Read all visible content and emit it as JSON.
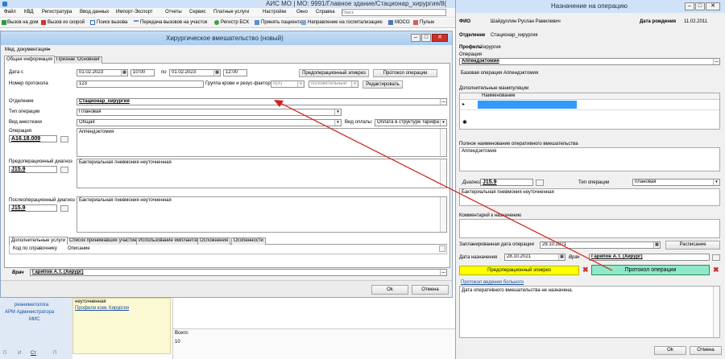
{
  "app": {
    "title": "АИС МО | МО: 9991/Главное здание/Стационар_хирургия/8("
  },
  "menu": {
    "items": [
      "Файл",
      "КВД",
      "Регистратура",
      "Ввод данных",
      "Импорт-Экспорт",
      "Отчеты",
      "Сервис",
      "Платные услуги",
      "Настройки",
      "Окно",
      "Справка"
    ],
    "search_placeholder": "Поиск"
  },
  "toolbar": {
    "items": [
      "Вызов на дом",
      "Вызов из скорой",
      "Поиск вызова",
      "Передача вызовов на участок",
      "Регистр БСК",
      "Принять пациента",
      "Направление на госпитализацию",
      "МОСО",
      "Пульм"
    ]
  },
  "surg": {
    "title": "Хирургическое вмешательство (новый)",
    "med_docs": "Мед. документация",
    "tabs": [
      "Общая информация",
      "Признак 'Основная'"
    ],
    "date_label": "Дата с",
    "date_from": "01.02.2023",
    "time_from": "10:00",
    "po": "по",
    "date_to": "01.02.2023",
    "time_to": "12:00",
    "btn_epicrisis": "Предоперационный эпикриз",
    "btn_protocol": "Протокол операции",
    "protocol_label": "Номер протокола",
    "protocol_value": "123",
    "blood_label": "Группа крови и резус-фактор",
    "blood_value": "II(A)",
    "rh_value": "положительный",
    "btn_edit": "Редактировать",
    "dept_label": "Отделение",
    "dept_value": "Стационар_хирургия",
    "optype_label": "Тип операции",
    "optype_value": "Плановая",
    "anest_label": "Вид анестезии",
    "anest_value": "Общая",
    "pay_label": "Вид оплаты:",
    "pay_value": "Оплата в структуре тарифа",
    "op_label": "Операция",
    "op_code": "A16.18.009",
    "op_text": "Аппендэктомия",
    "preop_label": "Предоперационный диагноз",
    "preop_code": "J15.9",
    "preop_text": "Бактериальная пневмония неуточненная",
    "postop_label": "Послеоперационный диагноз",
    "postop_code": "J15.9",
    "postop_text": "Бактериальная пневмония неуточненная",
    "subtabs": [
      "Дополнительные услуги",
      "Список принимавших участие",
      "Использование имплантов",
      "Осложнения",
      "Особенности"
    ],
    "col_code": "Код по справочнику",
    "col_desc": "Описание",
    "doctor_label": "Врач",
    "doctor_value": "Гарипов А.Т. (Хирург)",
    "btn_ok": "Ok",
    "btn_cancel": "Отмена"
  },
  "bg": {
    "left_items": [
      "реаниматолога",
      "АРМ Администратора",
      "МИС"
    ],
    "info_lines": [
      "неуточненная",
      "Профили коек Хирургия"
    ],
    "total_label": "Всего:",
    "total_value": "10",
    "bottom_tabs": [
      "П",
      "И",
      "Ст",
      "П"
    ]
  },
  "assign": {
    "title": "Назначение на операцию",
    "fio_label": "ФИО",
    "fio_value": "Шайдуллин Руслан Рамилевич",
    "dob_label": "Дата рождения",
    "dob_value": "11.02.2011",
    "dept_label": "Отделение",
    "dept_value": "Стационар_хирургия",
    "profile_label": "Профиль",
    "profile_value": "Хирургия",
    "op_label": "Операция",
    "op_value": "Аппендэктомия",
    "base_op": "Базовая операция  Аппендэктомия",
    "extra_label": "Дополнительные манипуляции",
    "extra_col": "Наименование",
    "full_label": "Полное наименование оперативного вмешательства",
    "full_value": "Аппендэктомия",
    "diag_label": "Диагноз",
    "diag_code": "J15.9",
    "diag_text": "Бактериальная пневмония неуточненная",
    "type_label": "Тип операции",
    "type_value": "плановая",
    "comment_label": "Комментарий к назначению",
    "planned_label": "Запланированная дата операции",
    "planned_value": "28.10.2021",
    "btn_schedule": "Расписание",
    "assign_date_label": "Дата назначения",
    "assign_date_value": "28.10.2021",
    "doctor_label": "Врач",
    "doctor_value": "Гарипов А.Т. (Хирург)",
    "btn_epicrisis": "Предоперационный эпикриз",
    "btn_protocol": "Протокол операции",
    "log_link": "Протокол ведения больного",
    "log_text": "Дата оперативного вмешательства не назначена.",
    "btn_ok": "Ok",
    "btn_cancel": "Отмена"
  },
  "colors": {
    "title_blue": "#cfe2f7",
    "surg_title": "#a9cdf1",
    "epicrisis_yellow": "#ffff00",
    "protocol_green": "#8fe8c8",
    "close_red": "#c9302c",
    "selected_row": "#3399ff",
    "arrow": "#d81b1b"
  }
}
